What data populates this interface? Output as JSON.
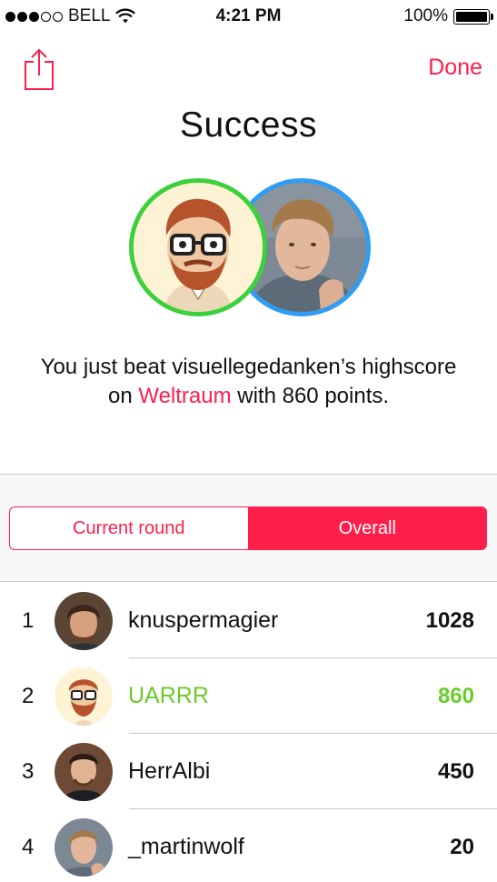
{
  "status_bar": {
    "carrier": "BELL",
    "time": "4:21 PM",
    "battery": "100%",
    "signal_bars_filled": 3,
    "signal_bars_total": 5
  },
  "nav": {
    "done_label": "Done",
    "share_icon": "share-icon"
  },
  "title": "Success",
  "message": {
    "before": "You just beat visuellegedanken’s highscore on ",
    "game": "Weltraum",
    "after": " with 860 points."
  },
  "segments": [
    {
      "label": "Current round",
      "active": false
    },
    {
      "label": "Overall",
      "active": true
    }
  ],
  "leaderboard": [
    {
      "rank": "1",
      "name": "knuspermagier",
      "score": "1028",
      "highlight": false
    },
    {
      "rank": "2",
      "name": "UARRR",
      "score": "860",
      "highlight": true
    },
    {
      "rank": "3",
      "name": "HerrAlbi",
      "score": "450",
      "highlight": false
    },
    {
      "rank": "4",
      "name": "_martinwolf",
      "score": "20",
      "highlight": false
    }
  ],
  "colors": {
    "accent": "#ff1f4b",
    "highlight": "#6acb2a",
    "player_ring": "#3cd13c",
    "opponent_ring": "#2f9df4"
  }
}
